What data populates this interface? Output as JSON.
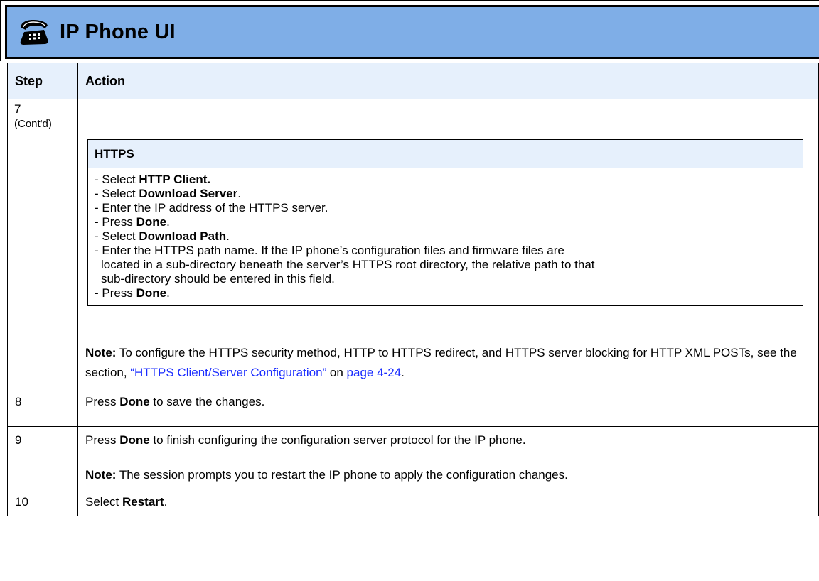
{
  "banner": {
    "title": "IP Phone UI",
    "icon": "phone-icon",
    "background": "#7faee7"
  },
  "table": {
    "headers": {
      "step": "Step",
      "action": "Action"
    },
    "header_background": "#e6f0fc"
  },
  "row7": {
    "step": "7",
    "step_note": "(Cont'd)",
    "box_title": "HTTPS",
    "lines": [
      {
        "prefix": "- Select ",
        "bold": "HTTP Client.",
        "suffix": ""
      },
      {
        "prefix": "- Select ",
        "bold": "Download Server",
        "suffix": "."
      },
      {
        "prefix": "- Enter the IP address of the HTTPS server.",
        "bold": "",
        "suffix": ""
      },
      {
        "prefix": "- Press ",
        "bold": "Done",
        "suffix": "."
      },
      {
        "prefix": "- Select ",
        "bold": "Download Path",
        "suffix": "."
      }
    ],
    "path_line_1": "- Enter the HTTPS path name. If the IP phone’s configuration files and firmware files are",
    "path_line_2": "located in a sub-directory beneath the server’s HTTPS root directory, the relative path to that",
    "path_line_3": "sub-directory should be entered in this field.",
    "last_prefix": "- Press ",
    "last_bold": "Done",
    "last_suffix": ".",
    "note_label": "Note:",
    "note_text": " To configure the HTTPS security method, HTTP to HTTPS redirect, and HTTPS server blocking for HTTP XML POSTs, see the section, ",
    "note_link": "“HTTPS Client/Server Configuration”",
    "note_on": " on ",
    "note_page_link": "page 4-24",
    "note_end": "."
  },
  "row8": {
    "step": "8",
    "prefix": "Press ",
    "bold": "Done",
    "suffix": " to save the changes."
  },
  "row9": {
    "step": "9",
    "prefix": "Press ",
    "bold": "Done",
    "suffix": " to finish configuring the configuration server protocol for the IP phone.",
    "note_label": "Note:",
    "note_text": " The session prompts you to restart the IP phone to apply the configuration changes."
  },
  "row10": {
    "step": "10",
    "prefix": "Select ",
    "bold": "Restart",
    "suffix": "."
  }
}
